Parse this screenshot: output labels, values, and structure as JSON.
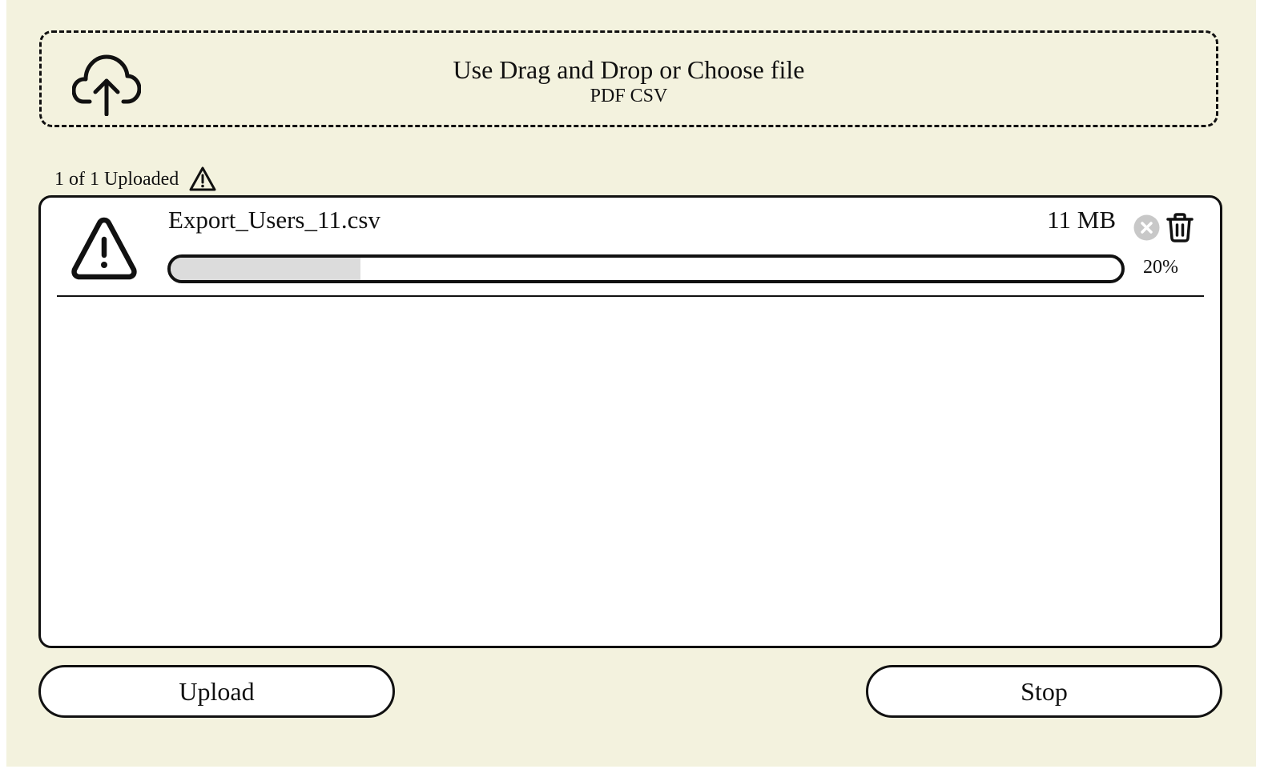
{
  "dropzone": {
    "title": "Use Drag and Drop or Choose file",
    "formats": "PDF CSV",
    "icon": "cloud-upload-icon"
  },
  "status": {
    "text": "1 of 1 Uploaded",
    "icon": "warning-icon"
  },
  "files": [
    {
      "name": "Export_Users_11.csv",
      "size": "11 MB",
      "status_icon": "warning-icon",
      "progress": 0.2,
      "progress_label": "20%",
      "actions": [
        "cancel-icon",
        "trash-icon"
      ]
    }
  ],
  "buttons": {
    "upload_label": "Upload",
    "stop_label": "Stop"
  },
  "colors": {
    "background": "#f3f2de",
    "panel": "#ffffff",
    "progress_fill": "#dcdcdc",
    "cancel_disabled": "#c8c8c8",
    "stroke": "#111111"
  }
}
